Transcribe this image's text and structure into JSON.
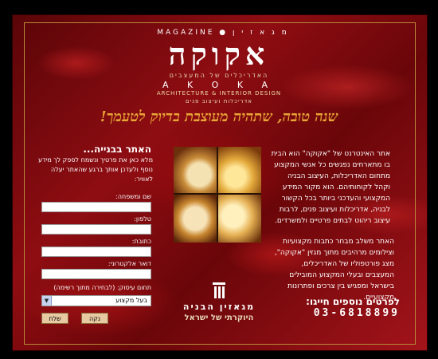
{
  "header": {
    "magazine_tag": "MAGAZINE ● מ ג א ז י ן",
    "logo": "אקוקה",
    "sub_heb": "האדריכלים של המעצבים",
    "akoka_en": "A K O K A",
    "sub_en": "ARCHITECTURE & INTERIOR DESIGN",
    "sub_heb2": "אדריכלות ועיצוב פנים"
  },
  "greeting": "שנה טובה, שתהיה מעוצבת בדיוק לטעמך!",
  "right_column": {
    "paragraph1": "אתר האינטרנט של \"אקוקה\" הוא הבית בו מתארחים נפגשים כל אנשי המקצוע מתחום האדריכלות, העיצוב הבניה וקהל לקוחותיהם. הוא מקור המידע המקצועי והעדכני ביותר בכל הקשור לבניה, אדריכלות ועיצוב פנים, לרבות עיצוב ריהוט לבתים פרטיים ולמשרדים.",
    "paragraph2": "האתר משלב מבחר כתבות מקצועיות וצילומים מרהיבים מתוך מגזין \"אקוקה\", מצג פורטפוליו של האדריכלים, המעצבים ובעלי המקצוע המובילים בישראל ומפגיש בין צרכים ופתרונות מקצועיים."
  },
  "contact": {
    "label": "לפרטים נוספים חייגו:",
    "phone": "03-6818899"
  },
  "form": {
    "title": "האתר בבנייה...",
    "intro": "מלא כאן את פרטיך ונשמח לספק לך מידע נוסף ולעדכן אותך ברגע שהאתר יעלה לאוויר:",
    "name_label": "שם ומשפחה:",
    "phone_label": "טלפון:",
    "address_label": "כתובת:",
    "email_label": "דואר אלקטרוני:",
    "field_label": "תחום עיסוק: (לבחירה מתוך רשימה)",
    "field_selected": "בעל מקצוע",
    "reset_label": "נקה",
    "submit_label": "שלח"
  },
  "bottom_logo": {
    "line1": "מגאזין הבניה",
    "line2": "היוקרתי של ישראל"
  }
}
